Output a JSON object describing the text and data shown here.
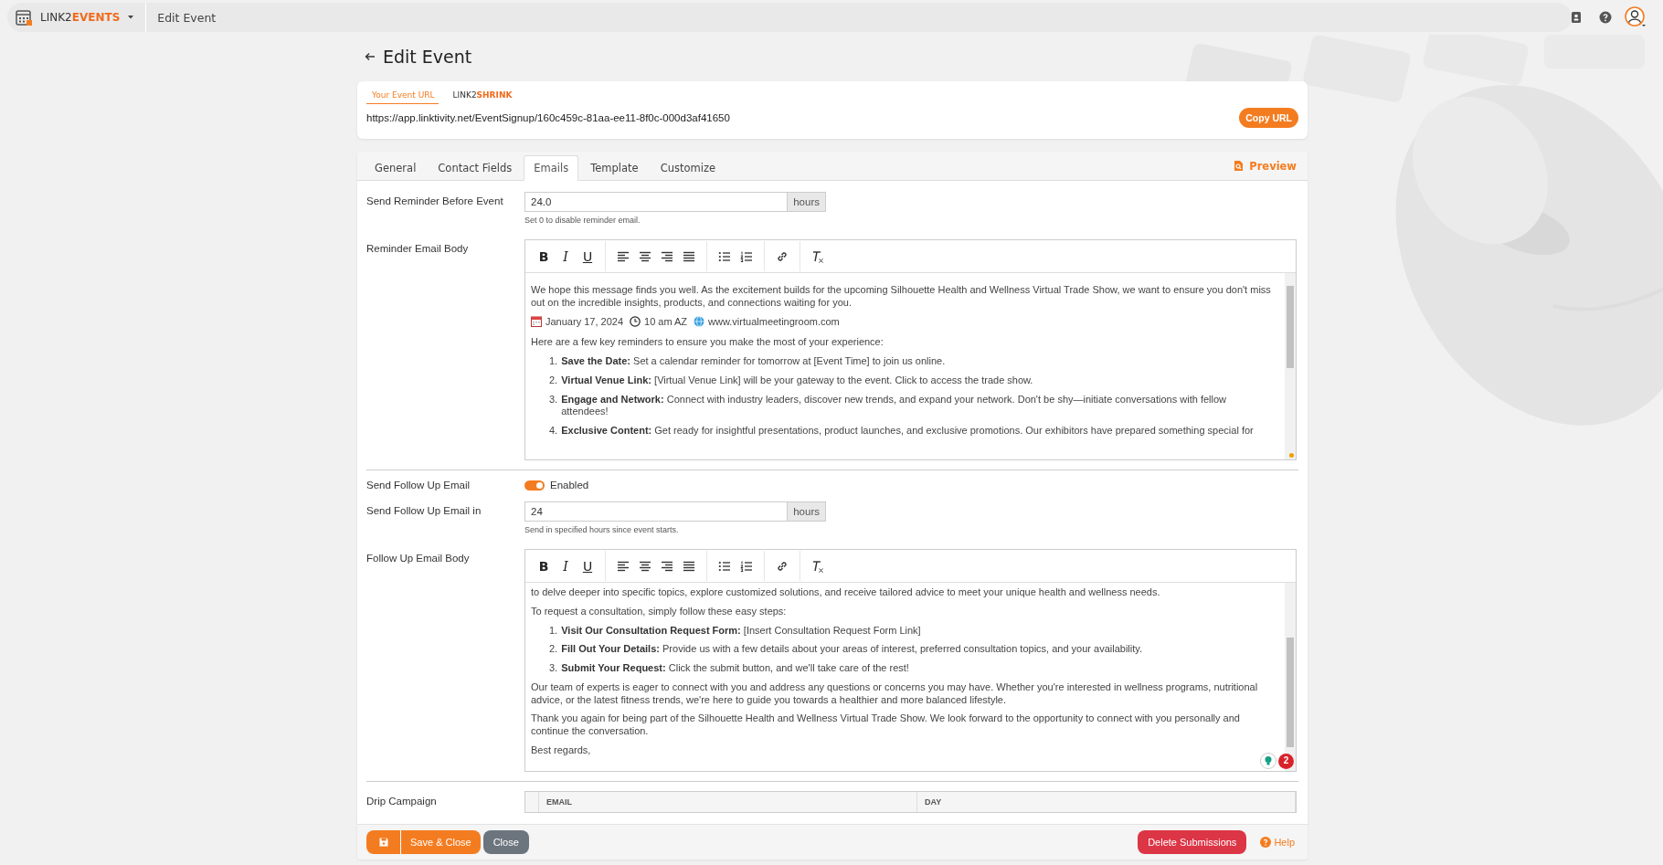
{
  "topbar": {
    "logo": "LINK2**EVENTS**",
    "breadcrumb": "Edit Event"
  },
  "page_title": "Edit Event",
  "url_card": {
    "tabs": [
      {
        "label": "Your Event URL",
        "selected": true
      },
      {
        "label": "LINK2**SHRINK**",
        "selected": false
      }
    ],
    "url": "https://app.linktivity.net/EventSignup/160c459c-81aa-ee11-8f0c-000d3af41650",
    "copy_button": "Copy URL"
  },
  "tabs": [
    {
      "label": "General",
      "selected": false
    },
    {
      "label": "Contact Fields",
      "selected": false
    },
    {
      "label": "Emails",
      "selected": true
    },
    {
      "label": "Template",
      "selected": false
    },
    {
      "label": "Customize",
      "selected": false
    }
  ],
  "preview": "Preview",
  "rows": [
    {
      "kind": "input",
      "label": "Send Reminder Before Event",
      "value": "24.0",
      "addon": "hours",
      "hint": "Set 0 to disable reminder email."
    },
    {
      "kind": "editor",
      "label": "Reminder Email Body",
      "toolbar": [
        {
          "kind": "bold",
          "glyph": "B"
        },
        {
          "kind": "italic",
          "glyph": "I"
        },
        {
          "kind": "underline",
          "glyph": "U"
        },
        {
          "kind": "align-left"
        },
        {
          "kind": "align-center"
        },
        {
          "kind": "align-right"
        },
        {
          "kind": "justify"
        },
        {
          "kind": "bullets"
        },
        {
          "kind": "numbers"
        },
        {
          "kind": "link"
        },
        {
          "kind": "clear"
        }
      ],
      "blocks": [
        {
          "kind": "para",
          "text": "We hope this message finds you well. As the excitement builds for the upcoming Silhouette Health and Wellness Virtual Trade Show, we want to ensure you don't miss out on the incredible insights, products, and connections waiting for you."
        },
        {
          "kind": "meta",
          "date": "January 17, 2024",
          "time": "10 am AZ",
          "site": "www.virtualmeetingroom.com"
        },
        {
          "kind": "para",
          "text": "Here are a few key reminders to ensure you make the most of your experience:"
        },
        {
          "kind": "list",
          "items": [
            {
              "number": "1.",
              "text": "**Save the Date:** Set a calendar reminder for tomorrow at [Event Time] to join us online."
            },
            {
              "number": "2.",
              "text": "**Virtual Venue Link:** [Virtual Venue Link] will be your gateway to the event. Click to access the trade show."
            },
            {
              "number": "3.",
              "text": "**Engage and Network:** Connect with industry leaders, discover new trends, and expand your network. Don't be shy—initiate conversations with fellow attendees!"
            },
            {
              "number": "4.",
              "text": "**Exclusive Content:** Get ready for insightful presentations, product launches, and exclusive promotions. Our exhibitors have prepared something special for"
            }
          ]
        }
      ]
    },
    {
      "kind": "toggle",
      "label": "Send Follow Up Email",
      "on": true,
      "text": "Enabled"
    },
    {
      "kind": "input",
      "label": "Send Follow Up Email in",
      "value": "24",
      "addon": "hours",
      "hint": "Send in specified hours since event starts."
    },
    {
      "kind": "editor",
      "label": "Follow Up Email Body",
      "assistant_badge": "2",
      "toolbar": [
        {
          "kind": "bold",
          "glyph": "B"
        },
        {
          "kind": "italic",
          "glyph": "I"
        },
        {
          "kind": "underline",
          "glyph": "U"
        },
        {
          "kind": "align-left"
        },
        {
          "kind": "align-center"
        },
        {
          "kind": "align-right"
        },
        {
          "kind": "justify"
        },
        {
          "kind": "bullets"
        },
        {
          "kind": "numbers"
        },
        {
          "kind": "link"
        },
        {
          "kind": "clear"
        }
      ],
      "blocks": [
        {
          "kind": "para",
          "text": "to delve deeper into specific topics, explore customized solutions, and receive tailored advice to meet your unique health and wellness needs."
        },
        {
          "kind": "para",
          "text": "To request a consultation, simply follow these easy steps:"
        },
        {
          "kind": "list",
          "items": [
            {
              "number": "1.",
              "text": "**Visit Our Consultation Request Form:** [Insert Consultation Request Form Link]"
            },
            {
              "number": "2.",
              "text": "**Fill Out Your Details:** Provide us with a few details about your areas of interest, preferred consultation topics, and your availability."
            },
            {
              "number": "3.",
              "text": "**Submit Your Request:** Click the submit button, and we'll take care of the rest!"
            }
          ]
        },
        {
          "kind": "para",
          "text": "Our team of experts is eager to connect with you and address any questions or concerns you may have. Whether you're interested in wellness programs, nutritional advice, or the latest fitness trends, we're here to guide you towards a healthier and more balanced lifestyle."
        },
        {
          "kind": "para",
          "text": "Thank you again for being part of the Silhouette Health and Wellness Virtual Trade Show. We look forward to the opportunity to connect with you personally and continue the conversation."
        },
        {
          "kind": "para",
          "text": "Best regards,"
        }
      ]
    },
    {
      "kind": "table",
      "label": "Drip Campaign",
      "columns": [
        "EMAIL",
        "DAY"
      ]
    }
  ],
  "footer": {
    "save_close": "Save & Close",
    "close": "Close",
    "delete": "Delete Submissions",
    "help": "Help"
  }
}
